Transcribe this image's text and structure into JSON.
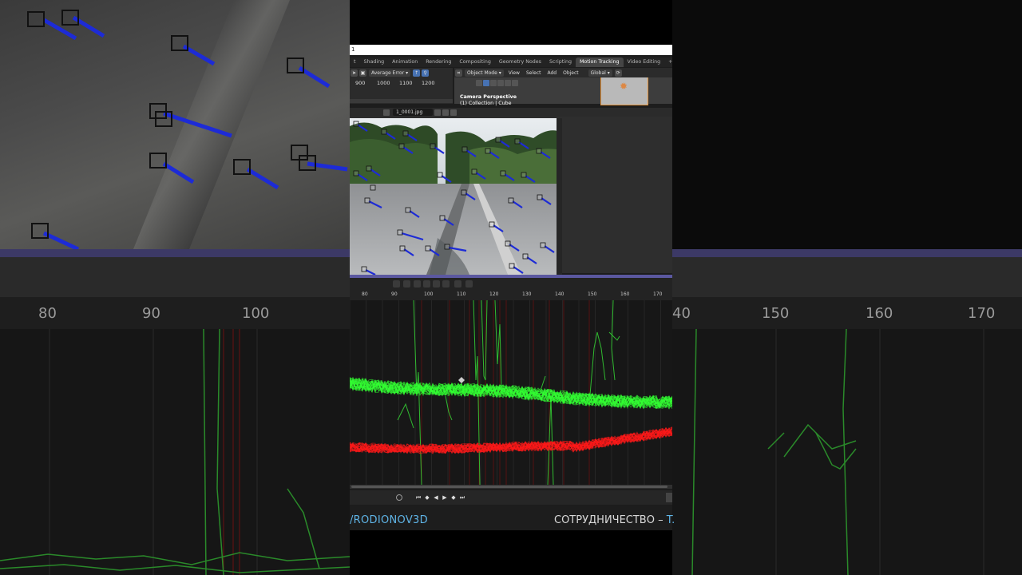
{
  "window": {
    "title_fragment": "1"
  },
  "workspace_tabs": [
    {
      "label": "t",
      "active": false
    },
    {
      "label": "Shading",
      "active": false
    },
    {
      "label": "Animation",
      "active": false
    },
    {
      "label": "Rendering",
      "active": false
    },
    {
      "label": "Compositing",
      "active": false
    },
    {
      "label": "Geometry Nodes",
      "active": false
    },
    {
      "label": "Scripting",
      "active": false
    },
    {
      "label": "Motion Tracking",
      "active": true
    },
    {
      "label": "Video Editing",
      "active": false
    },
    {
      "label": "+",
      "active": false
    }
  ],
  "dopesheet": {
    "sort_label": "Average Error",
    "frames": [
      "900",
      "1000",
      "1100",
      "1200"
    ]
  },
  "viewport": {
    "mode_label": "Object Mode",
    "menu": [
      "View",
      "Select",
      "Add",
      "Object"
    ],
    "orientation_label": "Global",
    "camera_label": "Camera Perspective",
    "collection_label": "(1) Collection | Cube"
  },
  "clip_editor": {
    "filename": "1_0001.jpg"
  },
  "graph": {
    "ruler_labels": [
      "80",
      "90",
      "100",
      "110",
      "120",
      "130",
      "140",
      "150",
      "160",
      "170"
    ],
    "bg_ruler_labels": [
      "80",
      "90",
      "100",
      "40",
      "150",
      "160",
      "170"
    ]
  },
  "playback": {
    "buttons": [
      "skip-start",
      "prev-keyframe",
      "play-reverse",
      "play",
      "next-keyframe",
      "skip-end"
    ]
  },
  "overlay": {
    "handle": "/RODIONOV3D",
    "promo_text": "СОТРУДНИЧЕСТВО – ",
    "promo_accent": "T."
  },
  "colors": {
    "green_curve": "#33ff33",
    "red_curve": "#ff1a1a",
    "track_blue": "#1d2bd6",
    "active_tab": "#454545",
    "timeline_purple": "#5b58a0",
    "accent_blue": "#5fb4e6"
  },
  "icons": {
    "editor_type": "camera-icon",
    "play": "play-icon",
    "record": "record-icon"
  }
}
